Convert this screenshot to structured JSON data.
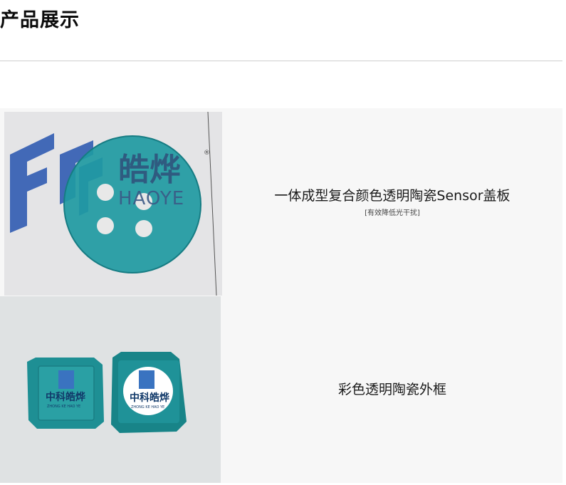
{
  "page": {
    "title": "产品展示"
  },
  "products": [
    {
      "name": "一体成型复合颜色透明陶瓷Sensor盖板",
      "subtitle": "[有效降低光干扰]",
      "image_brand_text": "皓烨",
      "image_brand_latin": "HAOYE"
    },
    {
      "name": "彩色透明陶瓷外框",
      "subtitle": "",
      "image_brand_text": "中科皓烨",
      "image_brand_latin": "ZHONG KE HAO YE"
    }
  ],
  "colors": {
    "teal_ceramic": "#1f9aa2",
    "logo_blue": "#2f5fb0",
    "divider": "#cfcfcf"
  }
}
